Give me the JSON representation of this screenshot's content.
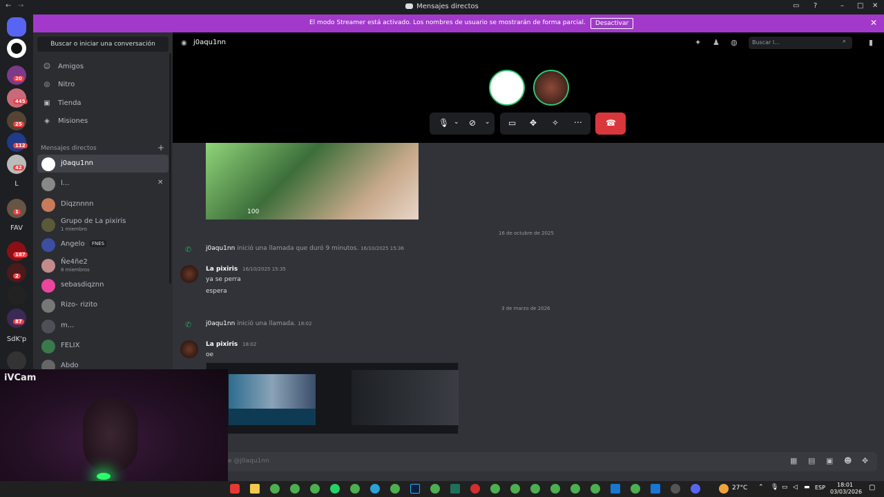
{
  "window": {
    "title": "Mensajes directos"
  },
  "banner": {
    "text": "El modo Streamer está activado. Los nombres de usuario se mostrarán de forma parcial.",
    "button": "Desactivar"
  },
  "servers": {
    "badges": [
      "20",
      "445",
      "25",
      "112",
      "42",
      "1",
      "187",
      "2",
      "87"
    ],
    "labels": [
      "L",
      "FAV",
      "SdK'p"
    ]
  },
  "sidebar": {
    "search": "Buscar o iniciar una conversación",
    "nav": [
      {
        "label": "Amigos",
        "icon": "friends-icon"
      },
      {
        "label": "Nitro",
        "icon": "nitro-icon"
      },
      {
        "label": "Tienda",
        "icon": "shop-icon"
      },
      {
        "label": "Misiones",
        "icon": "quests-icon"
      }
    ],
    "dm_header": "Mensajes directos",
    "dms": [
      {
        "name": "j0aqu1nn",
        "sub": ""
      },
      {
        "name": "l...",
        "sub": ""
      },
      {
        "name": "Diqznnnn",
        "sub": ""
      },
      {
        "name": "Grupo de La pixiris",
        "sub": "1 miembro"
      },
      {
        "name": "Angelo",
        "sub": ""
      },
      {
        "name": "Ñe4ñe2",
        "sub": "8 miembros"
      },
      {
        "name": "sebasdiqznn",
        "sub": ""
      },
      {
        "name": "Rizo- rizito",
        "sub": ""
      },
      {
        "name": "m...",
        "sub": ""
      },
      {
        "name": "FELIX",
        "sub": ""
      },
      {
        "name": "Abdo",
        "sub": ""
      }
    ],
    "angelo_tag": "FNES"
  },
  "header": {
    "channel": "j0aqu1nn",
    "search_placeholder": "Buscar l..."
  },
  "chat": {
    "video_hp": "100",
    "date1": "16 de octubre de 2025",
    "call1": {
      "user": "j0aqu1nn",
      "text": "inició una llamada que duró 9 minutos.",
      "time": "16/10/2025 15:36"
    },
    "msg1": {
      "user": "La pixiris",
      "time": "16/10/2025 15:35",
      "lines": [
        "ya se perra",
        "espera"
      ]
    },
    "date2": "3 de marzo de 2026",
    "call2": {
      "user": "j0aqu1nn",
      "text": "inició una llamada.",
      "time": "18:02"
    },
    "msg2": {
      "user": "La pixiris",
      "time": "18:02",
      "line": "oe"
    },
    "input_placeholder": "e @j0aqu1nn"
  },
  "webcam": {
    "label": "iVCam"
  },
  "taskbar": {
    "temp": "27°C",
    "lang": "ESP",
    "time": "18:01",
    "date": "03/03/2026"
  },
  "colors": {
    "accent": "#a239ca",
    "hangup": "#da373c",
    "bg": "#313338",
    "sidebar": "#2b2d31",
    "rail": "#1e1f22"
  }
}
